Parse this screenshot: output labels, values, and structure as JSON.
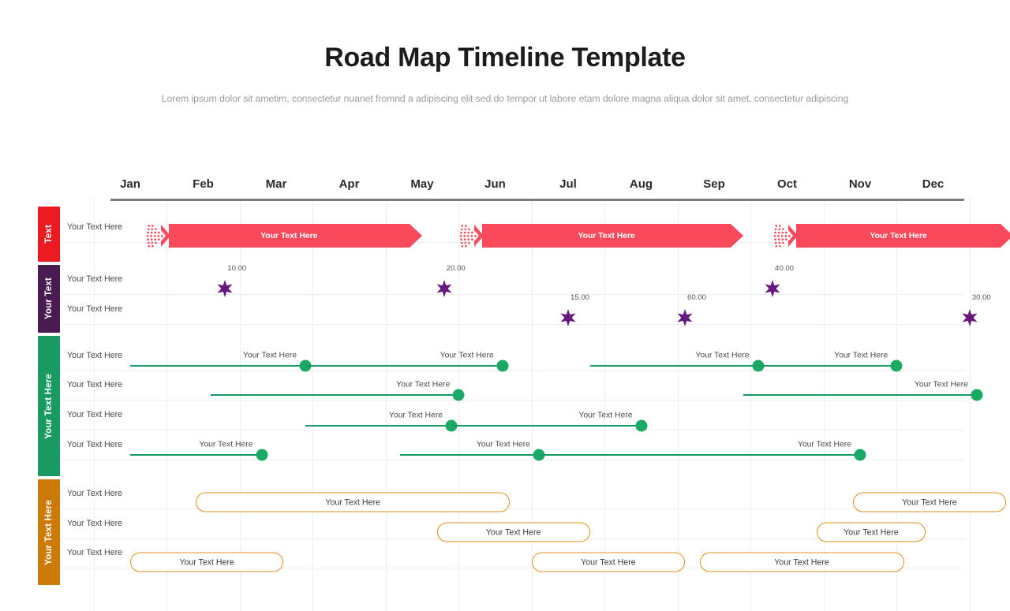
{
  "header": {
    "title": "Road Map Timeline Template",
    "subtitle": "Lorem ipsum dolor sit ametim, consectetur nuanet fromnd a adipiscing elit sed do tempor ut labore etam dolore magna aliqua dolor sit amet, consectetur adipiscing"
  },
  "colors": {
    "red": "#EC1B23",
    "red_bar": "#F9495B",
    "purple": "#4A1A52",
    "purple_star": "#67187F",
    "green": "#1A9A63",
    "green_dot": "#1BA966",
    "orange": "#CC7A08",
    "orange_pill_border": "#E1901B",
    "axis": "#7B7B7B",
    "grid": "#EDEDED"
  },
  "chart_data": {
    "type": "timeline",
    "title": "Road Map Timeline Template",
    "xlabel": "",
    "ylabel": "",
    "grid": true,
    "legend": "none",
    "months": [
      "Jan",
      "Feb",
      "Mar",
      "Apr",
      "May",
      "Jun",
      "Jul",
      "Aug",
      "Sep",
      "Oct",
      "Nov",
      "Dec"
    ],
    "categories": [
      {
        "label": "Text",
        "color": "#EC1B23",
        "type": "arrow-bar",
        "row_labels": [
          "Your Text Here"
        ],
        "items": [
          {
            "text": "Your Text Here",
            "start_month": 1.2,
            "end_month": 5.0
          },
          {
            "text": "Your Text Here",
            "start_month": 5.5,
            "end_month": 9.4
          },
          {
            "text": "Your Text Here",
            "start_month": 9.8,
            "end_month": 13.1
          }
        ]
      },
      {
        "label": "Your Text",
        "color": "#4A1A52",
        "type": "star-marker",
        "row_labels": [
          "Your Text Here",
          "Your Text Here"
        ],
        "items": [
          {
            "value": "10.00",
            "month": 2.3,
            "row": 0
          },
          {
            "value": "20.00",
            "month": 5.3,
            "row": 0
          },
          {
            "value": "40.00",
            "month": 9.8,
            "row": 0
          },
          {
            "value": "15.00",
            "month": 7.0,
            "row": 1
          },
          {
            "value": "60.00",
            "month": 8.6,
            "row": 1
          },
          {
            "value": "30.00",
            "month": 12.5,
            "row": 1
          }
        ]
      },
      {
        "label": "Your Text Here",
        "color": "#1A9A63",
        "type": "milestone-line",
        "row_labels": [
          "Your Text Here",
          "Your Text Here",
          "Your Text Here",
          "Your Text Here"
        ],
        "items": [
          {
            "text": "Your Text Here",
            "row": 0,
            "start_month": 1.0,
            "end_month": 3.4
          },
          {
            "text": "Your Text Here",
            "row": 0,
            "start_month": 3.4,
            "end_month": 6.1
          },
          {
            "text": "Your Text Here",
            "row": 0,
            "start_month": 7.3,
            "end_month": 9.6
          },
          {
            "text": "Your Text Here",
            "row": 0,
            "start_month": 9.6,
            "end_month": 11.5
          },
          {
            "text": "Your Text Here",
            "row": 1,
            "start_month": 2.1,
            "end_month": 5.5
          },
          {
            "text": "Your Text Here",
            "row": 1,
            "start_month": 9.4,
            "end_month": 12.6
          },
          {
            "text": "Your Text Here",
            "row": 2,
            "start_month": 3.4,
            "end_month": 5.4
          },
          {
            "text": "Your Text Here",
            "row": 2,
            "start_month": 5.4,
            "end_month": 8.0
          },
          {
            "text": "Your Text Here",
            "row": 3,
            "start_month": 1.0,
            "end_month": 2.8
          },
          {
            "text": "Your Text Here",
            "row": 3,
            "start_month": 4.7,
            "end_month": 6.6
          },
          {
            "text": "Your Text Here",
            "row": 3,
            "start_month": 6.6,
            "end_month": 11.0
          }
        ]
      },
      {
        "label": "Your Text Here",
        "color": "#CC7A08",
        "type": "pill",
        "row_labels": [
          "Your Text Here",
          "Your Text Here",
          "Your Text Here"
        ],
        "items": [
          {
            "text": "Your Text Here",
            "row": 0,
            "start_month": 1.9,
            "end_month": 6.2
          },
          {
            "text": "Your Text Here",
            "row": 0,
            "start_month": 10.9,
            "end_month": 13.0
          },
          {
            "text": "Your Text Here",
            "row": 1,
            "start_month": 5.2,
            "end_month": 7.3
          },
          {
            "text": "Your Text Here",
            "row": 1,
            "start_month": 10.4,
            "end_month": 11.9
          },
          {
            "text": "Your Text Here",
            "row": 2,
            "start_month": 1.0,
            "end_month": 3.1
          },
          {
            "text": "Your Text Here",
            "row": 2,
            "start_month": 6.5,
            "end_month": 8.6
          },
          {
            "text": "Your Text Here",
            "row": 2,
            "start_month": 8.8,
            "end_month": 11.6
          }
        ]
      }
    ]
  }
}
